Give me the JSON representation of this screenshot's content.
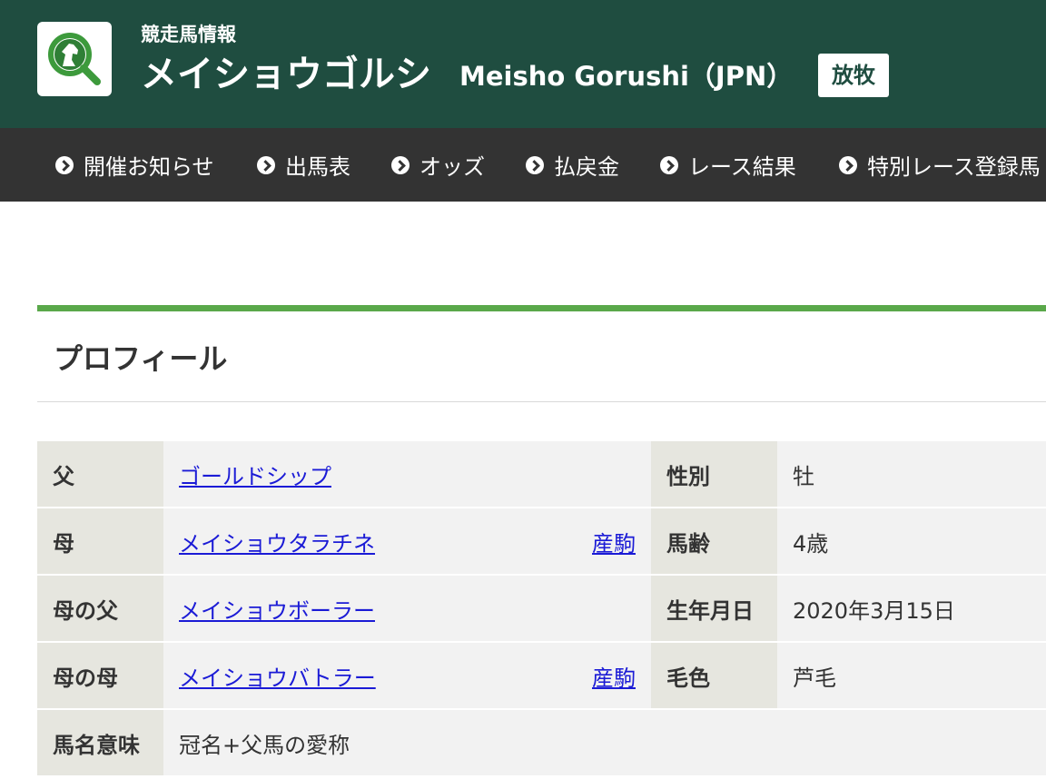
{
  "header": {
    "kicker": "競走馬情報",
    "name_ja": "メイショウゴルシ",
    "name_en": "Meisho Gorushi（JPN）",
    "status": "放牧",
    "background_color": "#1f4d40",
    "logo_icon": "horse-search-icon"
  },
  "nav": {
    "items": [
      {
        "label": "開催お知らせ",
        "icon": "circle-chevron-right-icon"
      },
      {
        "label": "出馬表",
        "icon": "circle-chevron-right-icon"
      },
      {
        "label": "オッズ",
        "icon": "circle-chevron-right-icon"
      },
      {
        "label": "払戻金",
        "icon": "circle-chevron-right-icon"
      },
      {
        "label": "レース結果",
        "icon": "circle-chevron-right-icon"
      },
      {
        "label": "特別レース登録馬",
        "icon": "circle-chevron-right-icon"
      }
    ]
  },
  "section": {
    "title": "プロフィール",
    "accent_color": "#5aa84a"
  },
  "profile": {
    "rows": [
      {
        "label": "父",
        "value": "ゴールドシップ",
        "offspring": "",
        "label2": "性別",
        "value2": "牡"
      },
      {
        "label": "母",
        "value": "メイショウタラチネ",
        "offspring": "産駒",
        "label2": "馬齢",
        "value2": "4歳"
      },
      {
        "label": "母の父",
        "value": "メイショウボーラー",
        "offspring": "",
        "label2": "生年月日",
        "value2": "2020年3月15日"
      },
      {
        "label": "母の母",
        "value": "メイショウバトラー",
        "offspring": "産駒",
        "label2": "毛色",
        "value2": "芦毛"
      }
    ],
    "name_meaning_label": "馬名意味",
    "name_meaning": "冠名+父馬の愛称"
  }
}
